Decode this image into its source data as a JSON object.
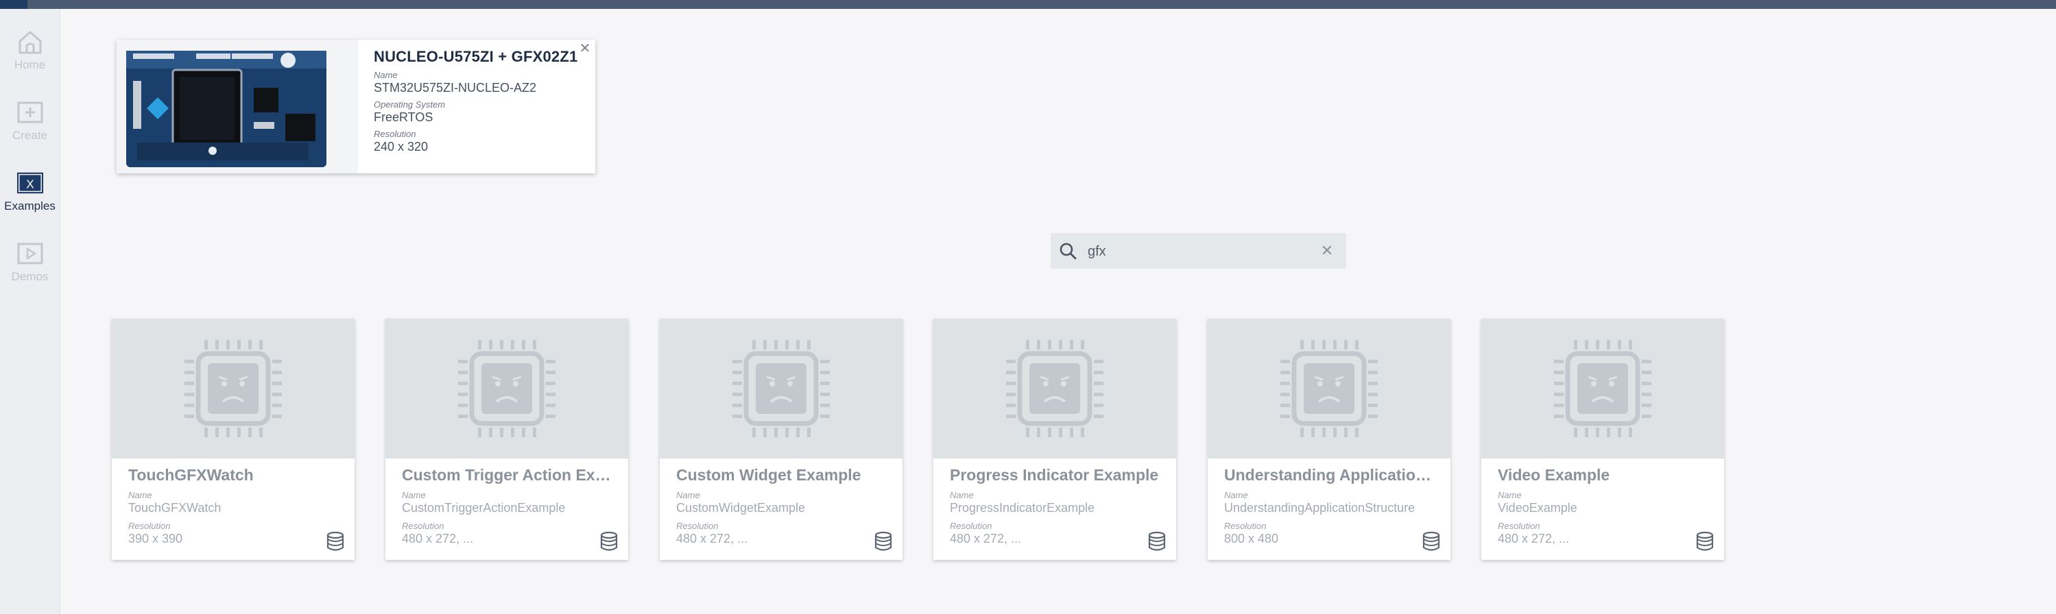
{
  "sidebar": {
    "items": [
      {
        "label": "Home",
        "icon": "home-icon"
      },
      {
        "label": "Create",
        "icon": "plus-box-icon"
      },
      {
        "label": "Examples",
        "icon": "x-box-icon",
        "active": true
      },
      {
        "label": "Demos",
        "icon": "play-box-icon"
      }
    ]
  },
  "board": {
    "title": "NUCLEO-U575ZI + GFX02Z1",
    "name_label": "Name",
    "name_value": "STM32U575ZI-NUCLEO-AZ2",
    "os_label": "Operating System",
    "os_value": "FreeRTOS",
    "resolution_label": "Resolution",
    "resolution_value": "240 x 320",
    "close_glyph": "✕"
  },
  "search": {
    "value": "gfx",
    "clear_glyph": "✕"
  },
  "examples": [
    {
      "title": "TouchGFXWatch",
      "name_label": "Name",
      "name": "TouchGFXWatch",
      "res_label": "Resolution",
      "resolution": "390 x 390"
    },
    {
      "title": "Custom Trigger Action Exa...",
      "name_label": "Name",
      "name": "CustomTriggerActionExample",
      "res_label": "Resolution",
      "resolution": "480 x 272, ..."
    },
    {
      "title": "Custom Widget Example",
      "name_label": "Name",
      "name": "CustomWidgetExample",
      "res_label": "Resolution",
      "resolution": "480 x 272, ..."
    },
    {
      "title": "Progress Indicator Example",
      "name_label": "Name",
      "name": "ProgressIndicatorExample",
      "res_label": "Resolution",
      "resolution": "480 x 272, ..."
    },
    {
      "title": "Understanding Application...",
      "name_label": "Name",
      "name": "UnderstandingApplicationStructure",
      "res_label": "Resolution",
      "resolution": "800 x 480"
    },
    {
      "title": "Video Example",
      "name_label": "Name",
      "name": "VideoExample",
      "res_label": "Resolution",
      "resolution": "480 x 272, ..."
    }
  ],
  "colors": {
    "topbar": "#4a5a70",
    "sidebar": "#eceef1",
    "active_nav": "#1e3a66",
    "card_thumb": "#dfe2e5"
  }
}
